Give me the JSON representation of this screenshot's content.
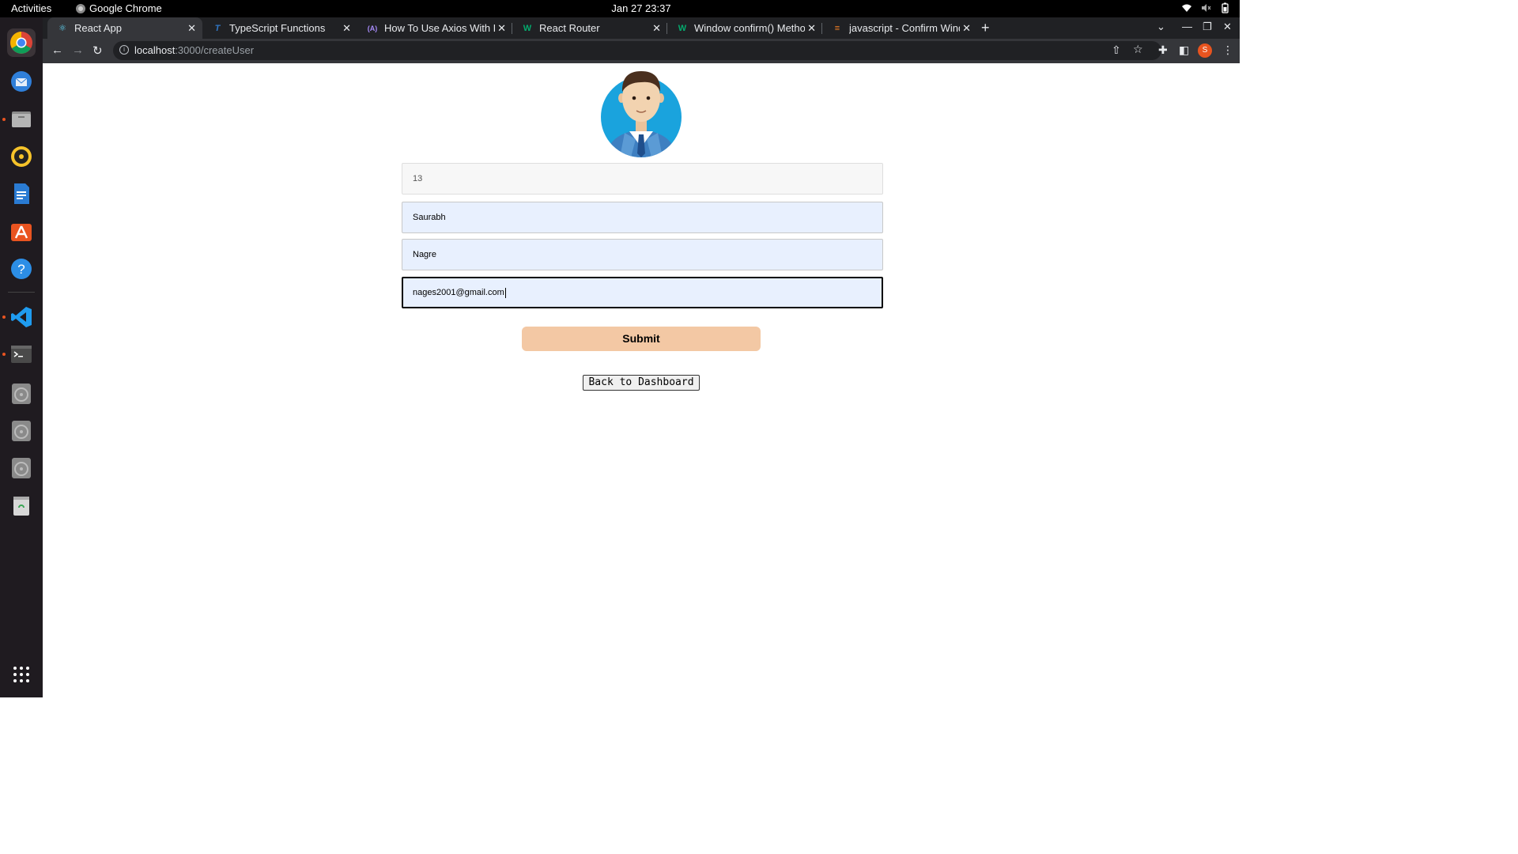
{
  "system_bar": {
    "activities": "Activities",
    "app_name": "Google Chrome",
    "clock": "Jan 27  23:37"
  },
  "dock": {
    "items": [
      "chrome-icon",
      "thunderbird-icon",
      "files-icon",
      "rhythmbox-icon",
      "writer-icon",
      "app-center-icon",
      "help-icon",
      "vscode-icon",
      "terminal-icon",
      "disc-icon",
      "disc-icon",
      "disc-icon",
      "trash-icon",
      "app-grid-icon"
    ]
  },
  "browser": {
    "tabs": [
      {
        "title": "React App",
        "icon": "react-icon",
        "active": true
      },
      {
        "title": "TypeScript Functions",
        "icon": "typescript-icon",
        "active": false
      },
      {
        "title": "How To Use Axios With Re",
        "icon": "axios-icon",
        "active": false
      },
      {
        "title": "React Router",
        "icon": "w3schools-icon",
        "active": false
      },
      {
        "title": "Window confirm() Metho",
        "icon": "w3schools-icon",
        "active": false
      },
      {
        "title": "javascript - Confirm Wind",
        "icon": "stackoverflow-icon",
        "active": false
      }
    ],
    "url_host": "localhost",
    "url_path": ":3000/createUser",
    "profile_initial": "S"
  },
  "form": {
    "id_value": "13",
    "first_name_value": "Saurabh",
    "last_name_value": "Nagre",
    "email_value": "nages2001@gmail.com",
    "submit_label": "Submit",
    "back_label": "Back to Dashboard"
  },
  "colors": {
    "submit_bg": "#f3c8a4",
    "autofill_bg": "#e8f0fe",
    "avatar_bg": "#1aa3dd"
  }
}
